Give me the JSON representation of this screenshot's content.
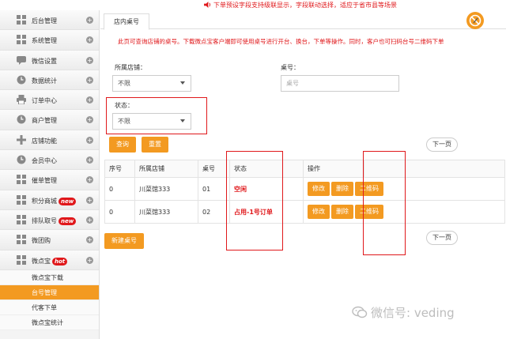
{
  "notice": {
    "text": "下单预设字段支持级联显示，字段联动选择，适应于省市县等场景"
  },
  "sidebar": {
    "items": [
      {
        "label": "后台管理",
        "icon": "grid-icon"
      },
      {
        "label": "系统管理",
        "icon": "grid-icon"
      },
      {
        "label": "微信设置",
        "icon": "chat-icon"
      },
      {
        "label": "数据统计",
        "icon": "clock-icon"
      },
      {
        "label": "订单中心",
        "icon": "printer-icon"
      },
      {
        "label": "商户管理",
        "icon": "clock-icon"
      },
      {
        "label": "店铺功能",
        "icon": "plus-icon"
      },
      {
        "label": "会员中心",
        "icon": "clock-icon"
      },
      {
        "label": "催单管理",
        "icon": "grid-icon"
      },
      {
        "label": "积分商城",
        "icon": "grid-icon",
        "badge": "new"
      },
      {
        "label": "排队取号",
        "icon": "grid-icon",
        "badge": "new"
      },
      {
        "label": "微团购",
        "icon": "grid-icon"
      },
      {
        "label": "微点宝",
        "icon": "grid-icon",
        "badge": "hot"
      }
    ],
    "subitems": [
      {
        "label": "微点宝下载",
        "active": false
      },
      {
        "label": "台号管理",
        "active": true
      },
      {
        "label": "代客下单",
        "active": false
      },
      {
        "label": "微点宝统计",
        "active": false
      }
    ]
  },
  "tab": {
    "label": "店内桌号"
  },
  "description": "此页可查询店铺的桌号。下载微点宝客户端即可使用桌号进行开台、换台，下单等操作。同时，客户也可扫码台号二维码下单",
  "filters": {
    "store_label": "所属店铺：",
    "store_value": "不限",
    "table_no_label": "桌号：",
    "table_no_placeholder": "桌号",
    "status_label": "状态：",
    "status_value": "不限"
  },
  "actions": {
    "search": "查询",
    "reset": "重置",
    "next_page": "下一页",
    "new_table": "新建桌号"
  },
  "table": {
    "headers": [
      "序号",
      "所属店铺",
      "桌号",
      "状态",
      "操作",
      ""
    ],
    "rows": [
      {
        "index": "0",
        "store": "川菜馆333",
        "number": "01",
        "status": "空闲",
        "edit": "修改",
        "delete": "删除",
        "qrcode": "二维码"
      },
      {
        "index": "0",
        "store": "川菜馆333",
        "number": "02",
        "status": "占用-1号订单",
        "edit": "修改",
        "delete": "删除",
        "qrcode": "二维码"
      }
    ]
  },
  "watermark": {
    "text": "微信号: veding"
  },
  "colors": {
    "accent": "#f39a21",
    "alert": "#e0181b"
  }
}
